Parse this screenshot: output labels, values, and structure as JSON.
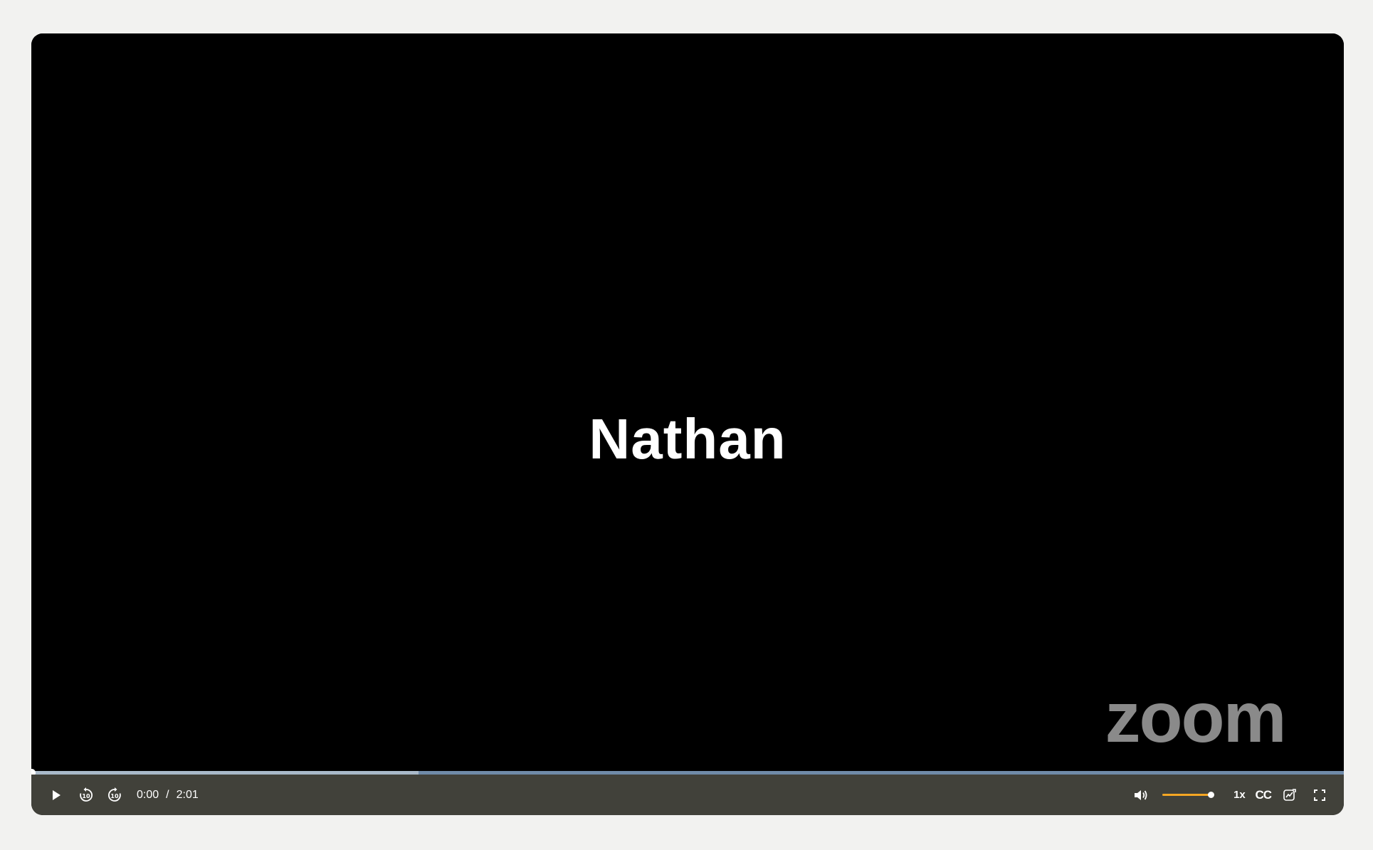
{
  "video": {
    "speaker_name": "Nathan",
    "watermark_text": "zoom"
  },
  "playback": {
    "current_time": "0:00",
    "separator": "/",
    "duration": "2:01",
    "played_fraction": 0.0,
    "buffered_fraction": 0.295,
    "speed_label": "1x"
  },
  "volume": {
    "level": 1.0,
    "accent_color": "#f5a623"
  },
  "captions": {
    "label": "CC"
  },
  "icons": {
    "play": "play-icon",
    "rewind": "rewind-10-icon",
    "forward": "forward-10-icon",
    "volume": "speaker-icon",
    "chapters": "chapters-icon",
    "fullscreen": "fullscreen-icon"
  },
  "colors": {
    "control_bar": "#41413a",
    "progress": "#6f8aa8",
    "page_background": "#f2f2f0"
  }
}
